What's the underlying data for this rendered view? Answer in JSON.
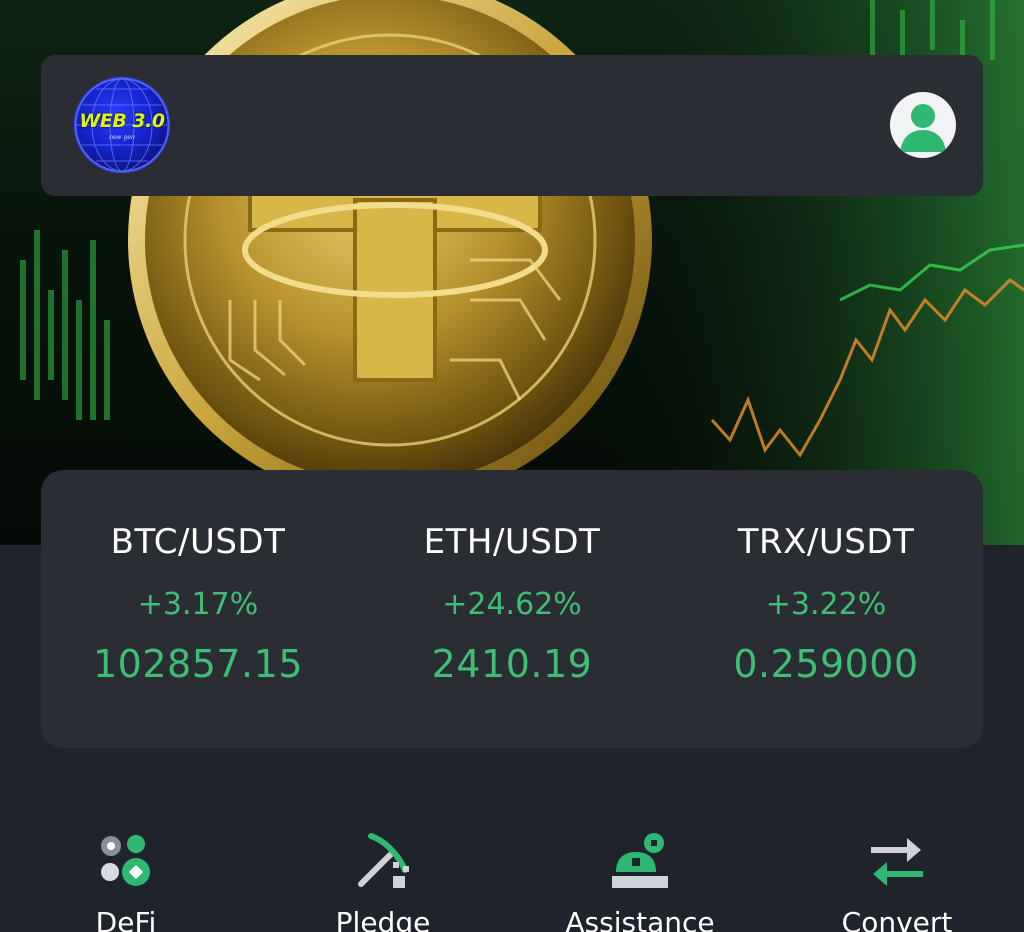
{
  "header": {
    "logo_text": "WEB 3.0",
    "logo_subtext": "new gen"
  },
  "ticker": [
    {
      "pair": "BTC/USDT",
      "change": "+3.17%",
      "price": "102857.15"
    },
    {
      "pair": "ETH/USDT",
      "change": "+24.62%",
      "price": "2410.19"
    },
    {
      "pair": "TRX/USDT",
      "change": "+3.22%",
      "price": "0.259000"
    }
  ],
  "menu": [
    {
      "label": "DeFi",
      "icon": "defi-icon"
    },
    {
      "label": "Pledge",
      "icon": "pledge-icon"
    },
    {
      "label": "Assistance",
      "icon": "assistance-icon"
    },
    {
      "label": "Convert",
      "icon": "convert-icon"
    }
  ],
  "colors": {
    "background": "#1f232b",
    "card": "#2a2d33",
    "positive": "#3dbf76",
    "text": "#ffffff",
    "logo_blue": "#1522c9",
    "logo_yellow": "#d9f21a"
  }
}
